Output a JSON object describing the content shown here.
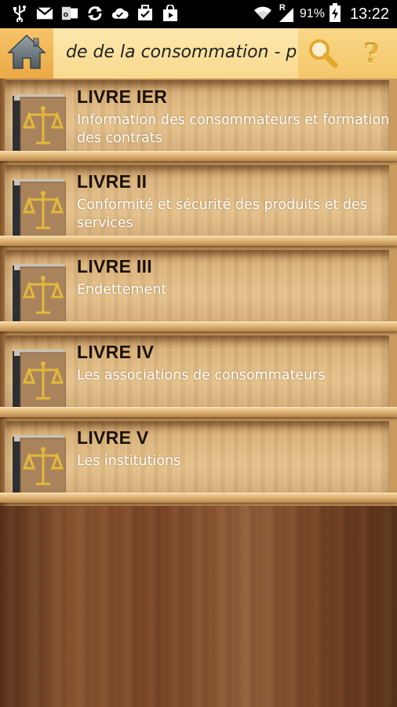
{
  "status_bar": {
    "battery_percent": "91%",
    "time": "13:22",
    "icons": [
      "usb-icon",
      "gmail-icon",
      "outlook-icon",
      "sync-icon",
      "cloud-check-icon",
      "briefcase-check-icon",
      "shopping-bag-icon",
      "wifi-icon",
      "roaming-signal-icon",
      "battery-charging-icon"
    ],
    "roaming_indicator": "R"
  },
  "action_bar": {
    "title": "de de la consommation - p",
    "help_label": "?"
  },
  "books": [
    {
      "title": "LIVRE IER",
      "subtitle": "Information des consommateurs et formation des contrats"
    },
    {
      "title": "LIVRE II",
      "subtitle": "Conformité et sécurité des produits et des services"
    },
    {
      "title": "LIVRE III",
      "subtitle": "Endettement"
    },
    {
      "title": "LIVRE IV",
      "subtitle": "Les associations de consommateurs"
    },
    {
      "title": "LIVRE V",
      "subtitle": "Les institutions"
    }
  ],
  "colors": {
    "action_bar": "#f8d98d",
    "book_title": "#1a1208",
    "book_subtitle": "#ffffff",
    "scales_gold": "#e2b93b"
  }
}
